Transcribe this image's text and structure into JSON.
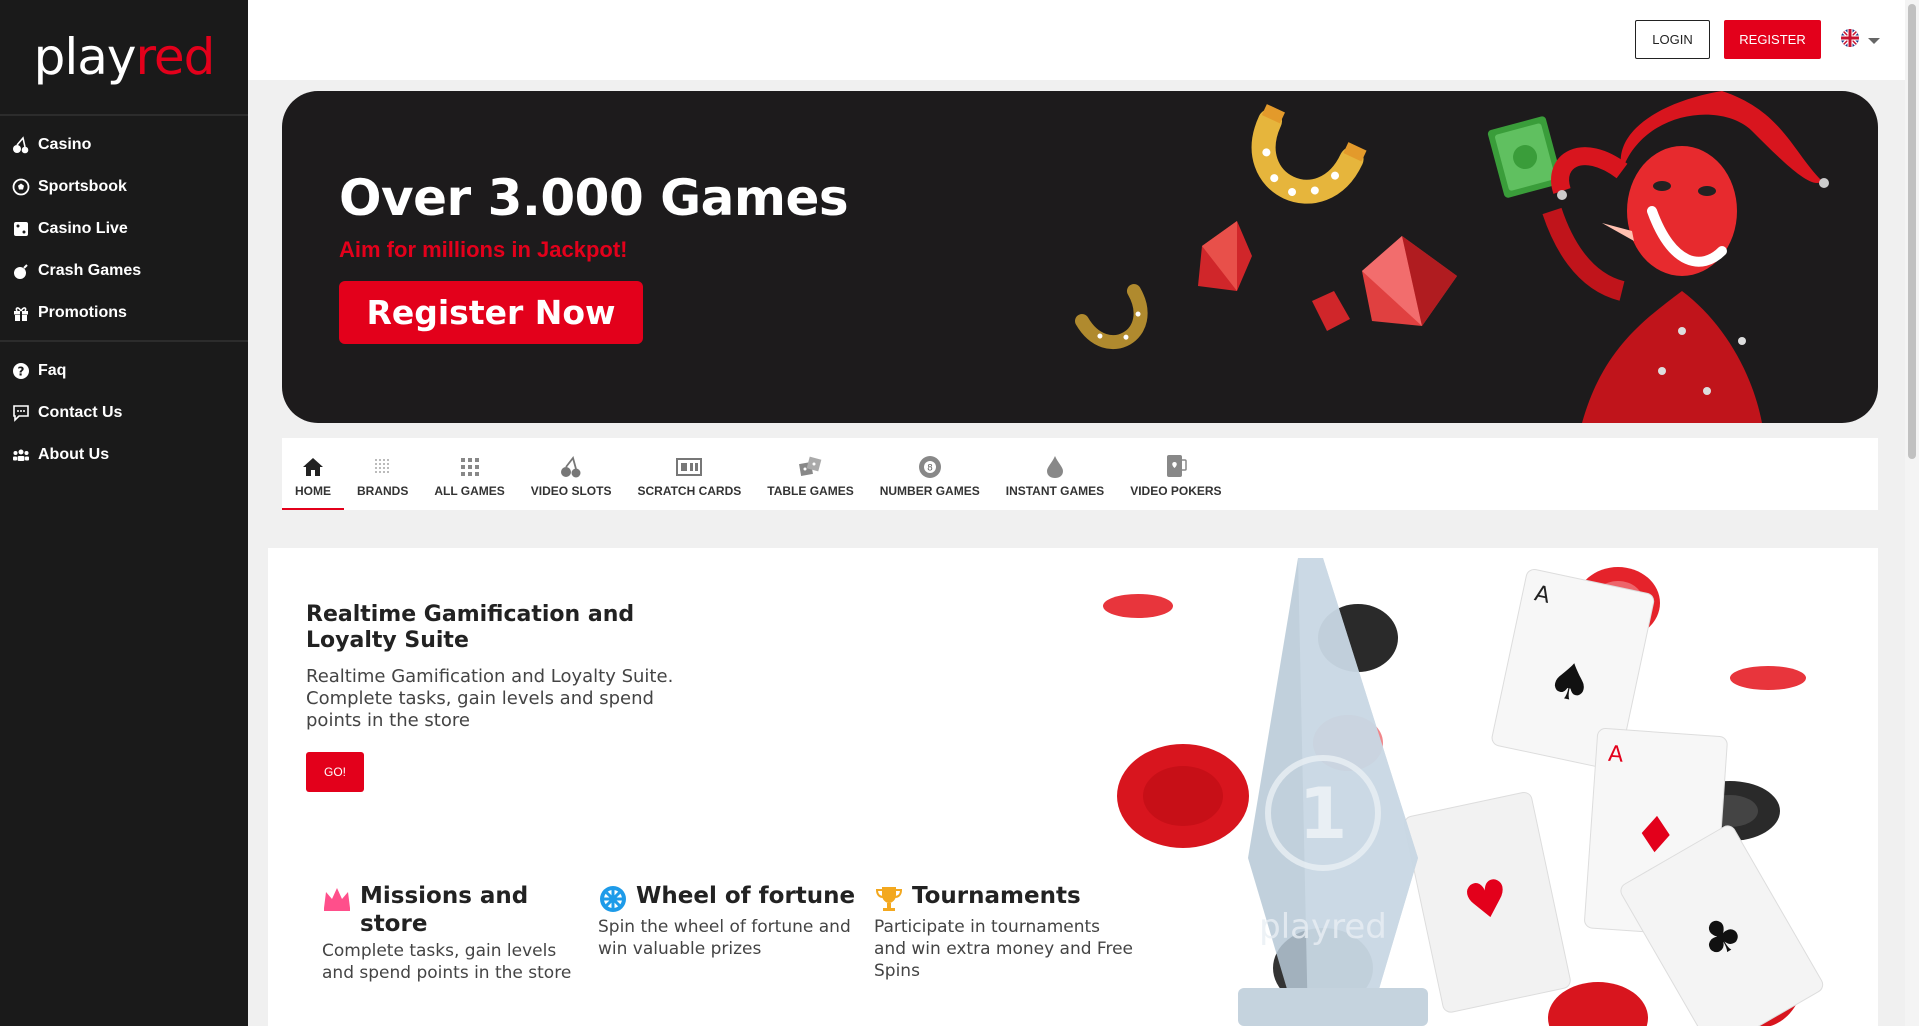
{
  "brand": {
    "part1": "play",
    "part2": "red",
    "accent": "#e3001b"
  },
  "sidebar": {
    "groups": [
      [
        {
          "icon": "cherries-icon",
          "label": "Casino"
        },
        {
          "icon": "soccer-ball-icon",
          "label": "Sportsbook"
        },
        {
          "icon": "dice-icon",
          "label": "Casino Live"
        },
        {
          "icon": "bomb-icon",
          "label": "Crash Games"
        },
        {
          "icon": "gift-icon",
          "label": "Promotions"
        }
      ],
      [
        {
          "icon": "question-icon",
          "label": "Faq"
        },
        {
          "icon": "chat-icon",
          "label": "Contact Us"
        },
        {
          "icon": "users-icon",
          "label": "About Us"
        }
      ]
    ]
  },
  "header": {
    "login_label": "LOGIN",
    "register_label": "REGISTER",
    "language_icon": "uk-flag-icon"
  },
  "hero": {
    "title": "Over 3.000 Games",
    "subtitle": "Aim for millions in Jackpot!",
    "cta_label": "Register Now"
  },
  "tabs": [
    {
      "icon": "home-icon",
      "label": "HOME",
      "active": true
    },
    {
      "icon": "brands-icon",
      "label": "BRANDS"
    },
    {
      "icon": "grid-icon",
      "label": "ALL GAMES"
    },
    {
      "icon": "cherries-icon",
      "label": "VIDEO SLOTS"
    },
    {
      "icon": "scratch-card-icon",
      "label": "SCRATCH CARDS"
    },
    {
      "icon": "dice-icon",
      "label": "TABLE GAMES"
    },
    {
      "icon": "lottery-ball-icon",
      "label": "NUMBER GAMES"
    },
    {
      "icon": "drop-icon",
      "label": "INSTANT GAMES"
    },
    {
      "icon": "poker-card-icon",
      "label": "VIDEO POKERS"
    }
  ],
  "loyalty": {
    "title": "Realtime Gamification and Loyalty Suite",
    "description": "Realtime Gamification and Loyalty Suite. Complete tasks, gain levels and spend points in the store",
    "go_label": "GO!",
    "features": [
      {
        "icon": "crown-icon",
        "title": "Missions and store",
        "description": "Complete tasks, gain levels and spend points in the store"
      },
      {
        "icon": "wheel-icon",
        "title": "Wheel of fortune",
        "description": "Spin the wheel of fortune and win valuable prizes"
      },
      {
        "icon": "trophy-icon",
        "title": "Tournaments",
        "description": "Participate in tournaments and win extra money and Free Spins"
      }
    ],
    "trophy_number": "1",
    "trophy_brand": "playred"
  }
}
